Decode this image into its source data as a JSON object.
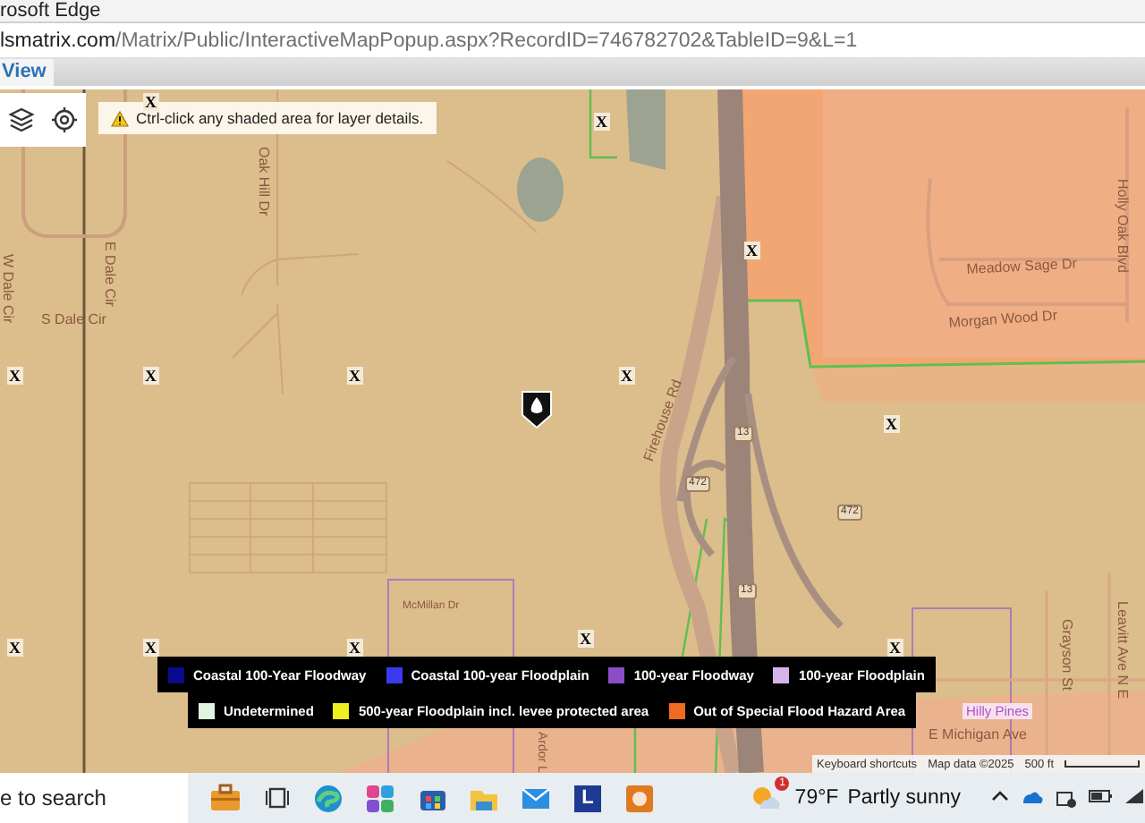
{
  "window": {
    "title": "rosoft Edge"
  },
  "address_bar": {
    "host": "lsmatrix.com",
    "path": "/Matrix/Public/InteractiveMapPopup.aspx?RecordID=746782702&TableID=9&L=1"
  },
  "menu": {
    "items": [
      {
        "label": "View",
        "selected": true
      }
    ]
  },
  "map": {
    "hint": "Ctrl-click any shaded area for layer details.",
    "streets": [
      "W Dale Cir",
      "E Dale Cir",
      "S Dale Cir",
      "Oak Hill Dr",
      "Firehouse Rd",
      "Meadow Sage Dr",
      "Morgan Wood Dr",
      "Holly Oak Blvd",
      "Grayson St",
      "Leavitt Ave N E",
      "E Michigan Ave",
      "Ardor L",
      "McMillan Dr"
    ],
    "places": [
      "Hilly Pines"
    ],
    "shields": [
      "13",
      "472",
      "472",
      "13"
    ],
    "zone_markers": [
      "X",
      "X",
      "X",
      "X",
      "X",
      "X",
      "X",
      "X",
      "X",
      "X",
      "X",
      "X",
      "X"
    ],
    "legend": [
      {
        "label": "Coastal 100-Year Floodway",
        "color": "#0a0a8c"
      },
      {
        "label": "Coastal 100-year Floodplain",
        "color": "#3a3aee"
      },
      {
        "label": "100-year Floodway",
        "color": "#8a4fc8"
      },
      {
        "label": "100-year Floodplain",
        "color": "#d4b4ee"
      },
      {
        "label": "Undetermined",
        "color": "#e0f4e0"
      },
      {
        "label": "500-year Floodplain incl. levee protected area",
        "color": "#f0f020"
      },
      {
        "label": "Out of Special Flood Hazard Area",
        "color": "#f06a20"
      }
    ],
    "attribution": [
      "Keyboard shortcuts",
      "Map data ©2025",
      "500 ft"
    ]
  },
  "taskbar": {
    "search": {
      "placeholder": "e to search"
    },
    "app_letter": "L",
    "weather": {
      "badge": "1",
      "temperature": "79°F",
      "condition": "Partly sunny"
    }
  }
}
